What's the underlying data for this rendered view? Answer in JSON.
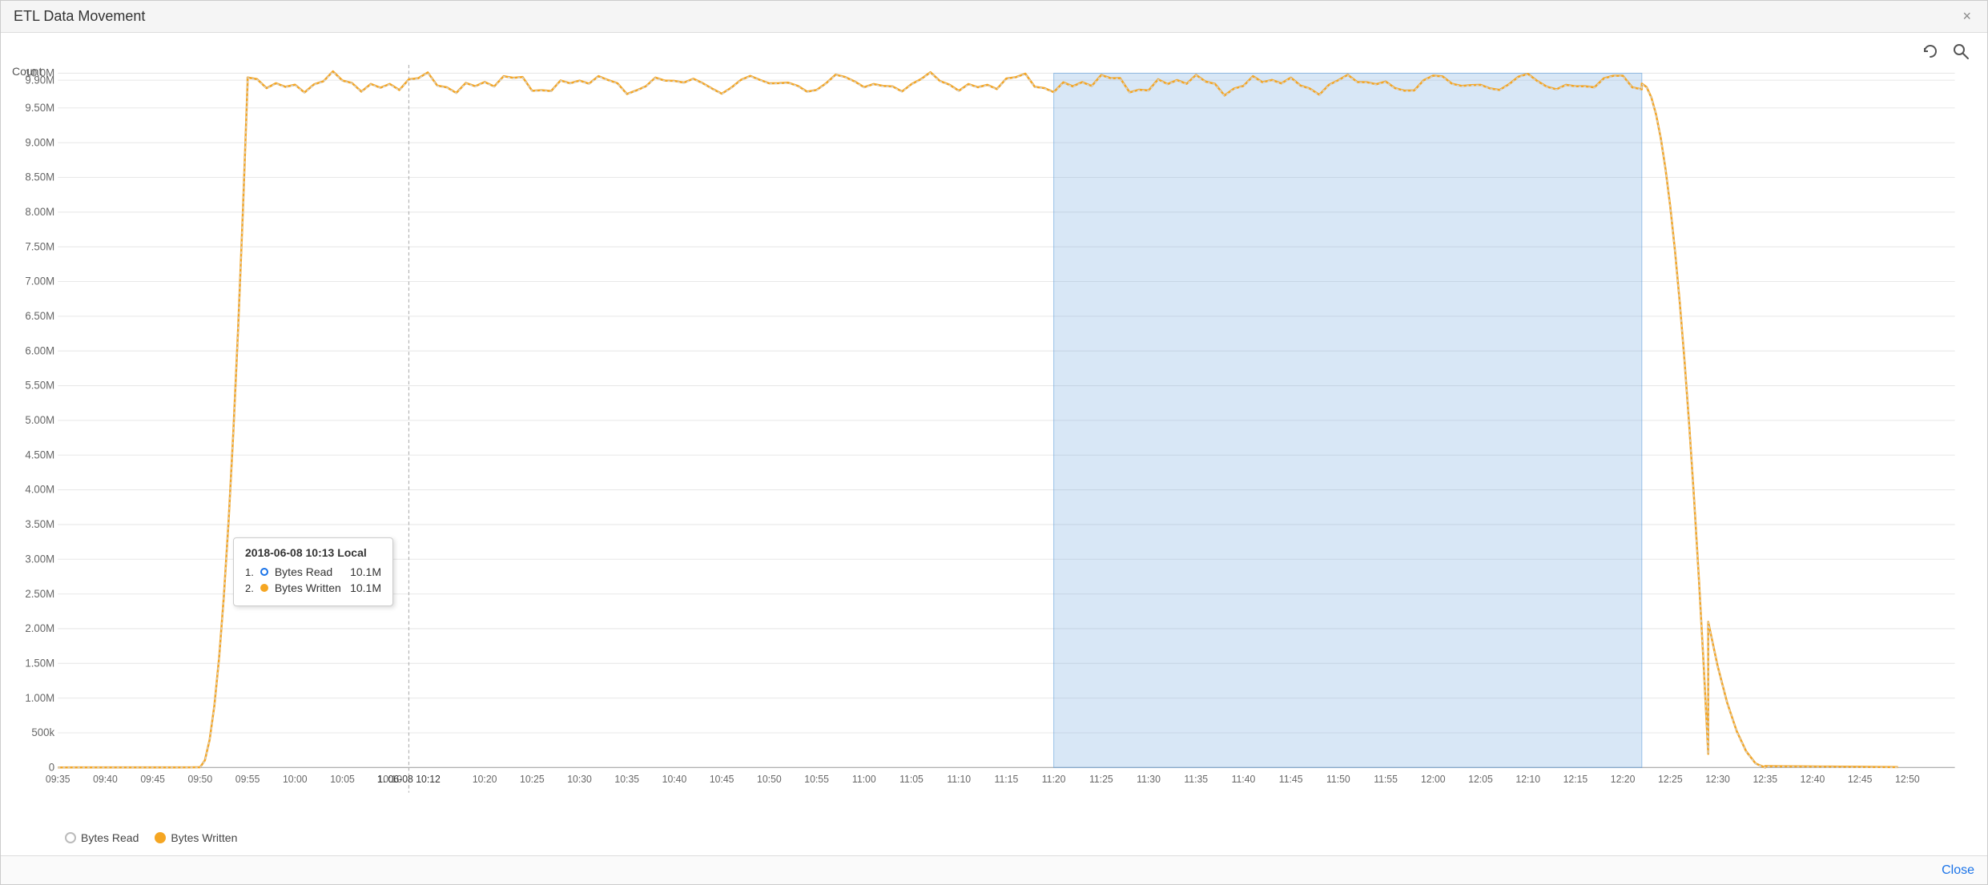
{
  "window": {
    "title": "ETL Data Movement",
    "close_label": "×"
  },
  "toolbar": {
    "refresh_icon": "↻",
    "search_icon": "🔍"
  },
  "chart": {
    "y_axis_label": "Count",
    "y_ticks": [
      {
        "label": "10.0M",
        "pct": 0
      },
      {
        "label": "9.90M",
        "pct": 1.0
      },
      {
        "label": "9.50M",
        "pct": 5.3
      },
      {
        "label": "9.00M",
        "pct": 10.5
      },
      {
        "label": "8.50M",
        "pct": 15.8
      },
      {
        "label": "8.00M",
        "pct": 21.1
      },
      {
        "label": "7.50M",
        "pct": 26.3
      },
      {
        "label": "7.00M",
        "pct": 31.6
      },
      {
        "label": "6.50M",
        "pct": 36.8
      },
      {
        "label": "6.00M",
        "pct": 42.1
      },
      {
        "label": "5.50M",
        "pct": 47.4
      },
      {
        "label": "5.00M",
        "pct": 52.6
      },
      {
        "label": "4.50M",
        "pct": 57.9
      },
      {
        "label": "4.00M",
        "pct": 63.2
      },
      {
        "label": "3.50M",
        "pct": 68.4
      },
      {
        "label": "3.00M",
        "pct": 73.7
      },
      {
        "label": "2.50M",
        "pct": 78.9
      },
      {
        "label": "2.00M",
        "pct": 84.2
      },
      {
        "label": "1.50M",
        "pct": 89.5
      },
      {
        "label": "1.00M",
        "pct": 94.7
      },
      {
        "label": "500k",
        "pct": 97.4
      },
      {
        "label": "0",
        "pct": 100
      }
    ],
    "x_ticks": [
      {
        "label": "09:35",
        "pct": 0
      },
      {
        "label": "09:40",
        "pct": 2.0
      },
      {
        "label": "09:45",
        "pct": 4.0
      },
      {
        "label": "09:50",
        "pct": 6.1
      },
      {
        "label": "09:55",
        "pct": 8.1
      },
      {
        "label": "10:00",
        "pct": 10.1
      },
      {
        "label": "1. 06-08 10:12",
        "pct": 11.4
      },
      {
        "label": "10:20",
        "pct": 14.2
      },
      {
        "label": "10:25",
        "pct": 16.2
      },
      {
        "label": "10:30",
        "pct": 18.2
      },
      {
        "label": "10:35",
        "pct": 20.3
      },
      {
        "label": "10:40",
        "pct": 22.3
      },
      {
        "label": "10:45",
        "pct": 24.3
      },
      {
        "label": "10:50",
        "pct": 26.3
      },
      {
        "label": "10:55",
        "pct": 28.3
      },
      {
        "label": "11:00",
        "pct": 30.4
      },
      {
        "label": "11:05",
        "pct": 32.4
      },
      {
        "label": "11:10",
        "pct": 34.4
      },
      {
        "label": "11:15",
        "pct": 36.4
      },
      {
        "label": "11:20",
        "pct": 38.4
      },
      {
        "label": "11:25",
        "pct": 40.5
      },
      {
        "label": "11:30",
        "pct": 42.5
      },
      {
        "label": "11:35",
        "pct": 44.5
      },
      {
        "label": "11:40",
        "pct": 46.5
      },
      {
        "label": "11:45",
        "pct": 48.5
      },
      {
        "label": "11:50",
        "pct": 50.5
      },
      {
        "label": "11:55",
        "pct": 52.5
      },
      {
        "label": "12:00",
        "pct": 54.6
      },
      {
        "label": "12:05",
        "pct": 56.6
      },
      {
        "label": "12:10",
        "pct": 58.6
      },
      {
        "label": "12:15",
        "pct": 60.6
      },
      {
        "label": "12:20",
        "pct": 62.6
      },
      {
        "label": "12:25",
        "pct": 64.7
      },
      {
        "label": "12:30",
        "pct": 66.7
      },
      {
        "label": "12:35",
        "pct": 68.7
      },
      {
        "label": "12:40",
        "pct": 70.7
      },
      {
        "label": "12:45",
        "pct": 72.7
      },
      {
        "label": "12:50",
        "pct": 74.8
      }
    ]
  },
  "legend": {
    "items": [
      {
        "label": "Bytes Read",
        "color": "#d4d4d4",
        "type": "circle-outline"
      },
      {
        "label": "Bytes Written",
        "color": "#f5a623",
        "type": "circle-fill"
      }
    ]
  },
  "tooltip": {
    "title": "2018-06-08 10:13 Local",
    "rows": [
      {
        "index": "1.",
        "dot_color": "white",
        "dot_border": "#1a73e8",
        "label": "Bytes Read",
        "value": "10.1M"
      },
      {
        "index": "2.",
        "dot_color": "#f5a623",
        "dot_border": "#f5a623",
        "label": "Bytes Written",
        "value": "10.1M"
      }
    ]
  },
  "bottom_bar": {
    "close_label": "Close"
  },
  "colors": {
    "line_written": "#f5a623",
    "line_read": "#d4d4d4",
    "grid": "#e8e8e8",
    "selection": "rgba(100,160,220,0.25)"
  }
}
